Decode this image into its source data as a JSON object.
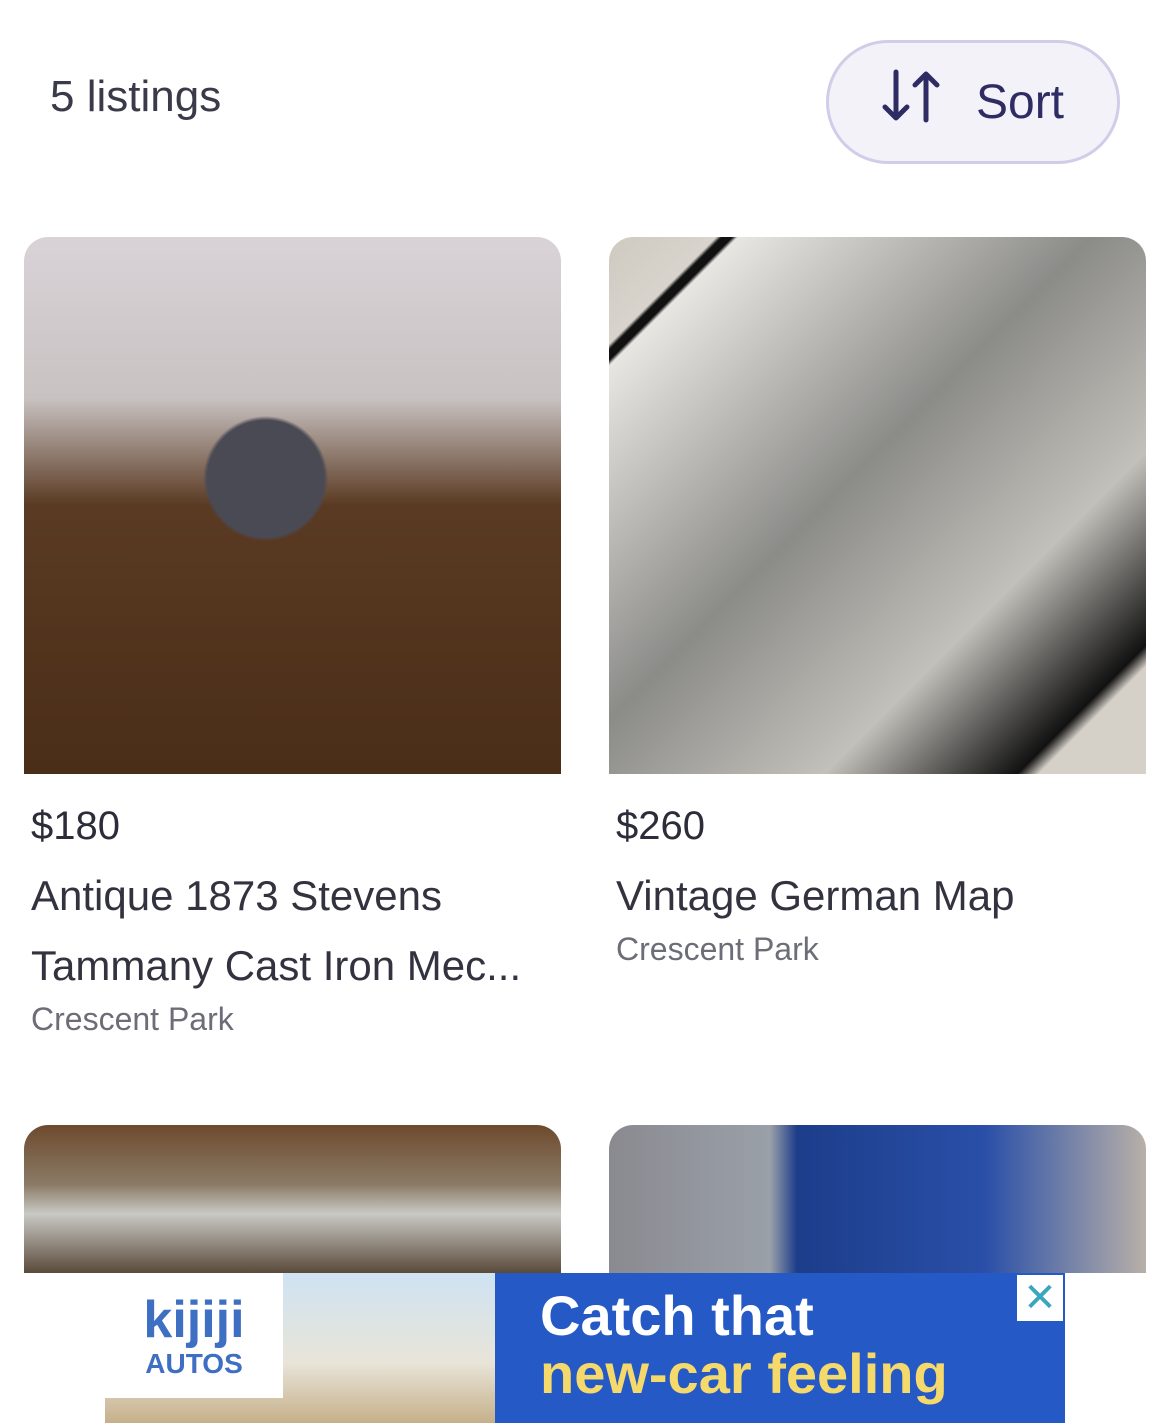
{
  "header": {
    "count": "5 listings",
    "sort_label": "Sort"
  },
  "listings": [
    {
      "price": "$180",
      "title": "Antique 1873 Stevens Tammany Cast Iron Mec...",
      "location": "Crescent Park"
    },
    {
      "price": "$260",
      "title": "Vintage German Map",
      "location": "Crescent Park"
    }
  ],
  "ad": {
    "logo_top": "kijiji",
    "logo_bottom": "AUTOS",
    "line1": "Catch that",
    "line2": "new-car feeling",
    "close": "✕"
  }
}
